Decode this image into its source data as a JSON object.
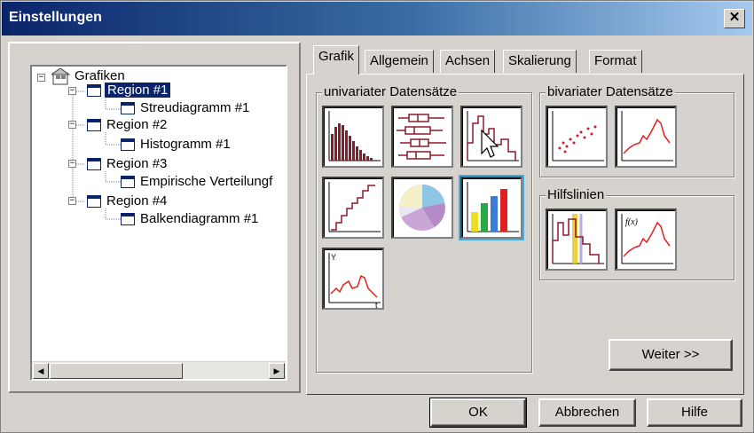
{
  "window": {
    "title": "Einstellungen",
    "close_glyph": "✕"
  },
  "tree": {
    "root": "Grafiken",
    "items": [
      {
        "label": "Region #1",
        "child": "Streudiagramm #1",
        "selected": true
      },
      {
        "label": "Region #2",
        "child": "Histogramm #1"
      },
      {
        "label": "Region #3",
        "child": "Empirische Verteilungf"
      },
      {
        "label": "Region #4",
        "child": "Balkendiagramm #1"
      }
    ],
    "scroll_left": "◀",
    "scroll_right": "▶"
  },
  "tabs": [
    {
      "label": "Grafik",
      "active": true
    },
    {
      "label": "Allgemein"
    },
    {
      "label": "Achsen"
    },
    {
      "label": "Skalierung"
    },
    {
      "label": "Format"
    }
  ],
  "groups": {
    "univariate": "univariater Datensätze",
    "bivariate": "bivariater Datensätze",
    "helpers": "Hilfslinien"
  },
  "tiles": {
    "univariate": [
      "histogram-bars-icon",
      "boxplot-icon",
      "histogram-outline-icon",
      "ecdf-step-icon",
      "pie-chart-icon",
      "bar-chart-icon",
      "time-series-icon"
    ],
    "bivariate": [
      "scatter-plot-icon",
      "line-plot-icon"
    ],
    "helpers": [
      "vertical-lines-icon",
      "function-curve-icon"
    ],
    "fx_label": "f(x)",
    "y_label": "Y",
    "t_label": "t"
  },
  "buttons": {
    "next": "Weiter >>",
    "ok": "OK",
    "cancel": "Abbrechen",
    "help": "Hilfe"
  }
}
